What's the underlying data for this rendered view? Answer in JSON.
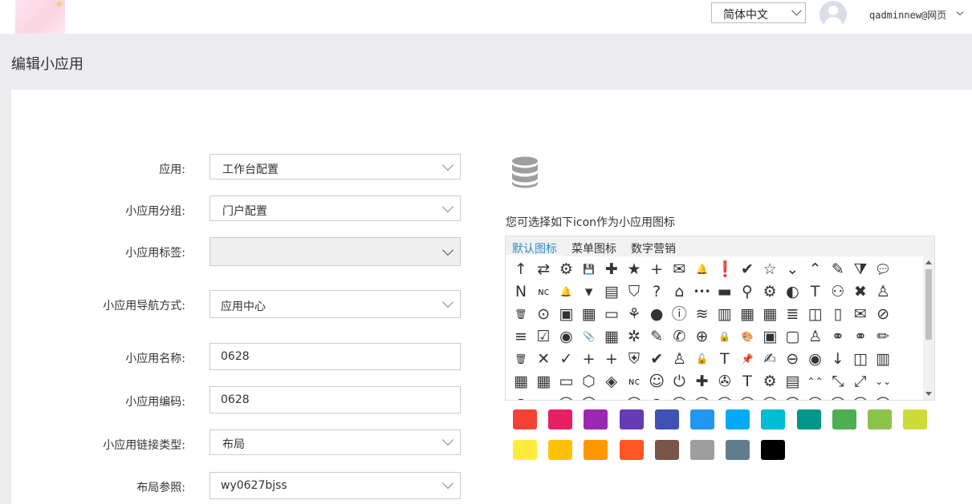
{
  "header": {
    "language": "简体中文",
    "user": "qadminnew@网页"
  },
  "page": {
    "title": "编辑小应用"
  },
  "form": {
    "app": {
      "label": "应用:",
      "value": "工作台配置"
    },
    "group": {
      "label": "小应用分组:",
      "value": "门户配置"
    },
    "tag": {
      "label": "小应用标签:",
      "value": ""
    },
    "nav": {
      "label": "小应用导航方式:",
      "value": "应用中心"
    },
    "name": {
      "label": "小应用名称:",
      "value": "0628"
    },
    "code": {
      "label": "小应用编码:",
      "value": "0628"
    },
    "link_type": {
      "label": "小应用链接类型:",
      "value": "布局"
    },
    "layout_ref": {
      "label": "布局参照:",
      "value": "wy0627bjss"
    }
  },
  "icon_picker": {
    "hint": "您可选择如下icon作为小应用图标",
    "tabs": [
      "默认图标",
      "菜单图标",
      "数字营销"
    ],
    "active_tab": 0
  },
  "colors": {
    "row1": [
      "#f44336",
      "#e91e63",
      "#9c27b0",
      "#673ab7",
      "#3f51b5",
      "#2196f3",
      "#03a9f4",
      "#00bcd4",
      "#009688",
      "#4caf50",
      "#8bc34a",
      "#cddc39"
    ],
    "row2": [
      "#ffeb3b",
      "#ffc107",
      "#ff9800",
      "#ff5722",
      "#795548",
      "#9e9e9e",
      "#607d8b",
      "#000000"
    ]
  }
}
